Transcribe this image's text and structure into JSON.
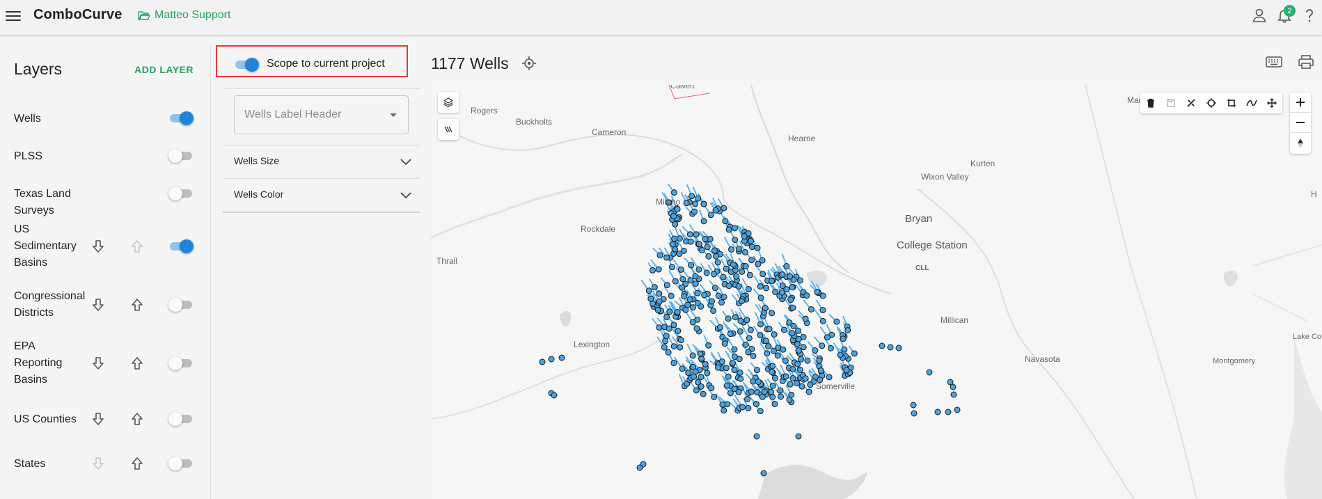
{
  "app": {
    "brand": "ComboCurve",
    "project": "Matteo Support",
    "notifications_count": "2"
  },
  "layers": {
    "title": "Layers",
    "add_label": "ADD LAYER",
    "items": [
      {
        "label": "Wells",
        "enabled": true,
        "down": false,
        "up": false
      },
      {
        "label": "PLSS",
        "enabled": false,
        "down": false,
        "up": false
      },
      {
        "label": "Texas Land Surveys",
        "enabled": false,
        "down": false,
        "up": false
      },
      {
        "label": "US Sedimentary Basins",
        "enabled": true,
        "down": true,
        "up": true
      },
      {
        "label": "Congressional Districts",
        "enabled": false,
        "down": true,
        "up": true
      },
      {
        "label": "EPA Reporting Basins",
        "enabled": false,
        "down": true,
        "up": true
      },
      {
        "label": "US Counties",
        "enabled": false,
        "down": true,
        "up": true
      },
      {
        "label": "States",
        "enabled": false,
        "down": true,
        "up": true
      }
    ]
  },
  "settings": {
    "scope_label": "Scope to current project",
    "scope_enabled": true,
    "label_header_placeholder": "Wells Label Header",
    "size_label": "Wells Size",
    "color_label": "Wells Color"
  },
  "map": {
    "wells_count_title": "1177 Wells",
    "places": [
      "Rogers",
      "Buckholts",
      "Cameron",
      "Hearne",
      "Kurten",
      "Wixon Valley",
      "Milano",
      "Bryan",
      "College Station",
      "CLL",
      "Rockdale",
      "Thrall",
      "Millican",
      "Lexington",
      "Navasota",
      "Somerville",
      "Montgomery",
      "Mad",
      "Lake Co",
      "H",
      "Calvert"
    ],
    "well_color": "#4aa3df",
    "accent_color": "#2184d8"
  }
}
